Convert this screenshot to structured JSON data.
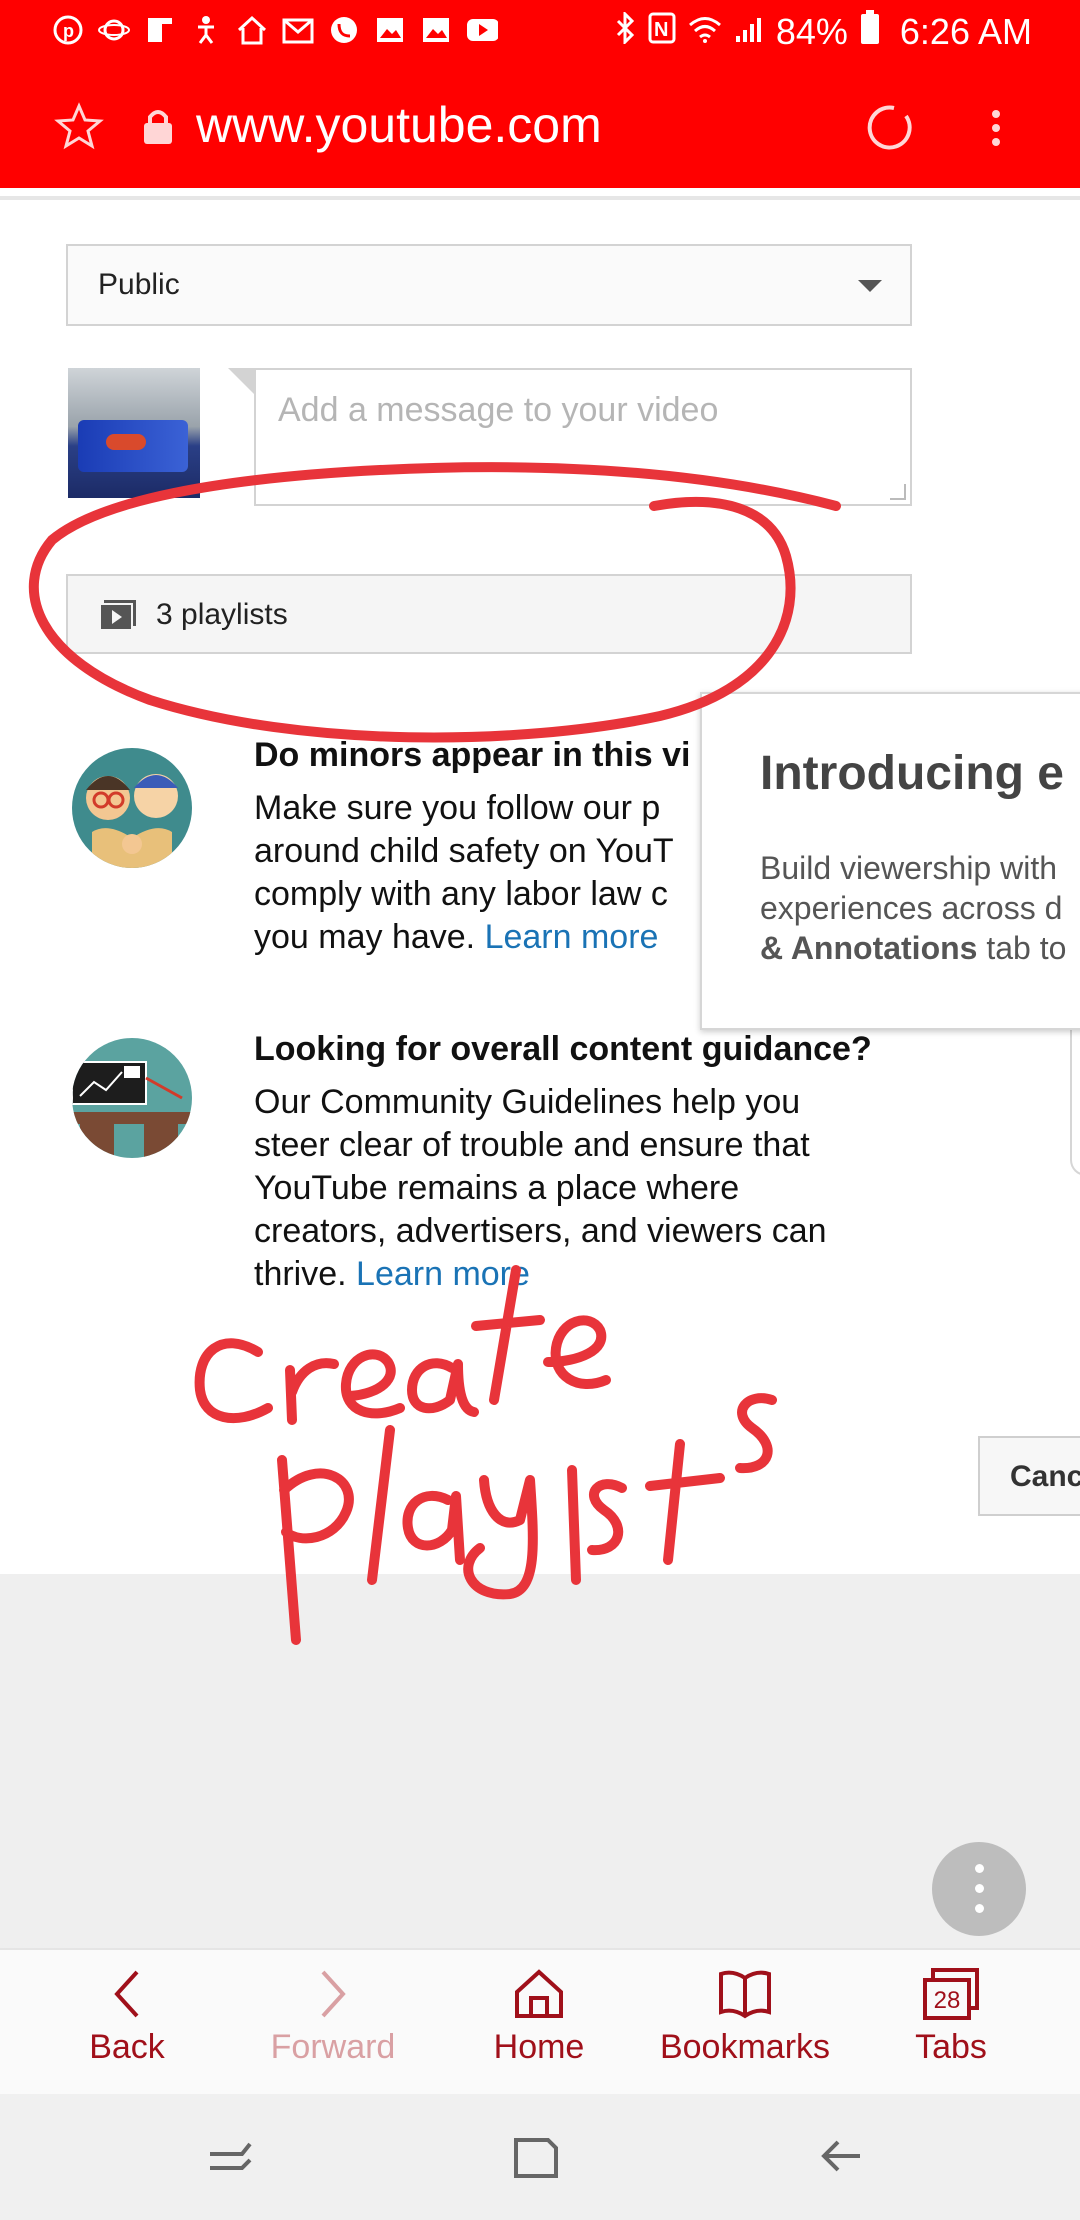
{
  "status_bar": {
    "left_icons": [
      "pinterest-icon",
      "saturn-icon",
      "flipboard-icon",
      "accessibility-icon",
      "home-app-icon",
      "gmail-icon",
      "phone-icon",
      "gallery-icon",
      "gallery-icon",
      "youtube-icon"
    ],
    "battery": "84%",
    "time": "6:26 AM"
  },
  "browser": {
    "url": "www.youtube.com"
  },
  "form": {
    "privacy_value": "Public",
    "message_placeholder": "Add a message to your video",
    "playlists_label": "3 playlists"
  },
  "guidance": [
    {
      "title": "Do minors appear in this vi",
      "body_lines": [
        "Make sure you follow our p",
        "around child safety on YouT",
        "comply with any labor law c",
        "you may have. "
      ],
      "link": "Learn more"
    },
    {
      "title": "Looking for overall content guidance?",
      "body_lines": [
        "Our Community Guidelines help you",
        "steer clear of trouble and ensure that",
        "YouTube remains a place where",
        "creators, advertisers, and viewers can",
        "thrive. "
      ],
      "link": "Learn more"
    }
  ],
  "popup": {
    "title": "Introducing e",
    "line1": "Build viewership with",
    "line2": "experiences across d",
    "line3_bold": "& Annotations",
    "line3_rest": " tab to"
  },
  "cancel_label": "Canc",
  "annotation": {
    "handwritten_text": "create playlists",
    "color": "#e8343a"
  },
  "bottom_nav": [
    {
      "label": "Back",
      "icon": "chevron-left-icon"
    },
    {
      "label": "Forward",
      "icon": "chevron-right-icon"
    },
    {
      "label": "Home",
      "icon": "home-icon"
    },
    {
      "label": "Bookmarks",
      "icon": "book-icon"
    },
    {
      "label": "Tabs",
      "icon": "tabs-icon",
      "count": "28"
    }
  ],
  "colors": {
    "brand_red": "#ff0000",
    "nav_red": "#a0101a",
    "link_blue": "#1a73b5"
  }
}
